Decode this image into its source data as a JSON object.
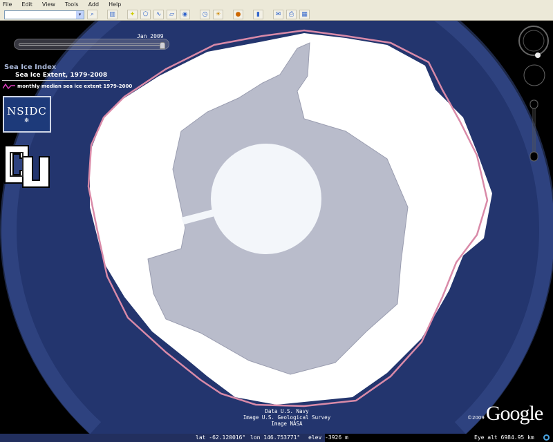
{
  "menu": [
    "File",
    "Edit",
    "View",
    "Tools",
    "Add",
    "Help"
  ],
  "toolbar": {
    "search_value": "",
    "icons": [
      "search-icon",
      "sidebar-icon",
      "placemark-icon",
      "polygon-icon",
      "path-icon",
      "image-overlay-icon",
      "tour-icon",
      "historical-imagery-icon",
      "sunlight-icon",
      "planets-icon",
      "ruler-icon",
      "email-icon",
      "print-icon"
    ]
  },
  "timeline": {
    "date": "Jan 2009",
    "position": 1.0
  },
  "overlay": {
    "title": "Sea Ice Index",
    "subtitle": "Sea Ice Extent, 1979-2008",
    "legend": "monthly median sea ice extent 1979-2000",
    "legend_color": "#e040c0",
    "nsidc_logo": "NSIDC",
    "cu_logo": "CU"
  },
  "attribution": [
    "Data U.S. Navy",
    "Image U.S. Geological Survey",
    "Image NASA"
  ],
  "google": {
    "copyright": "©2009",
    "logo": "Google"
  },
  "status": {
    "lat": "lat  -62.120016°",
    "lon": "lon  146.753771°",
    "elev": "elev -3926 m",
    "eye_alt": "Eye alt  6984.95 km"
  },
  "colors": {
    "ocean": "#23356e",
    "ice": "#ffffff",
    "median_line": "#d98aa8",
    "land": "#b9bccb"
  }
}
